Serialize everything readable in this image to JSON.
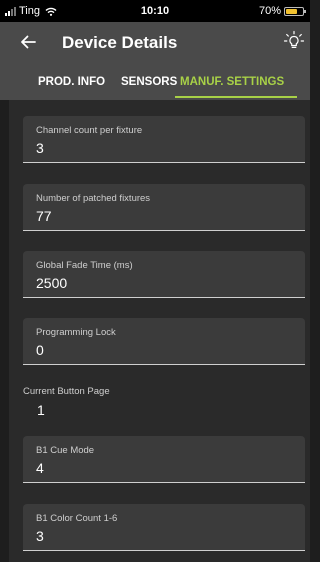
{
  "status_bar": {
    "carrier": "Ting",
    "time": "10:10",
    "battery": "70%",
    "battery_level": 0.7,
    "battery_color": "#f2c230"
  },
  "header": {
    "title": "Device Details",
    "back_icon": "arrow-left-icon",
    "light_icon": "lightbulb-icon"
  },
  "tabs": [
    {
      "label": "PROD. INFO",
      "active": false
    },
    {
      "label": "SENSORS",
      "active": false
    },
    {
      "label": "MANUF. SETTINGS",
      "active": true
    }
  ],
  "accent_color": "#a8d147",
  "fields": [
    {
      "label": "Channel count per fixture",
      "value": "3"
    },
    {
      "label": "Number of patched fixtures",
      "value": "77"
    },
    {
      "label": "Global Fade Time (ms)",
      "value": "2500"
    },
    {
      "label": "Programming Lock",
      "value": "0"
    },
    {
      "label": "Current Button Page",
      "value": "1"
    },
    {
      "label": "B1 Cue Mode",
      "value": "4"
    },
    {
      "label": "B1 Color Count 1-6",
      "value": "3"
    }
  ]
}
